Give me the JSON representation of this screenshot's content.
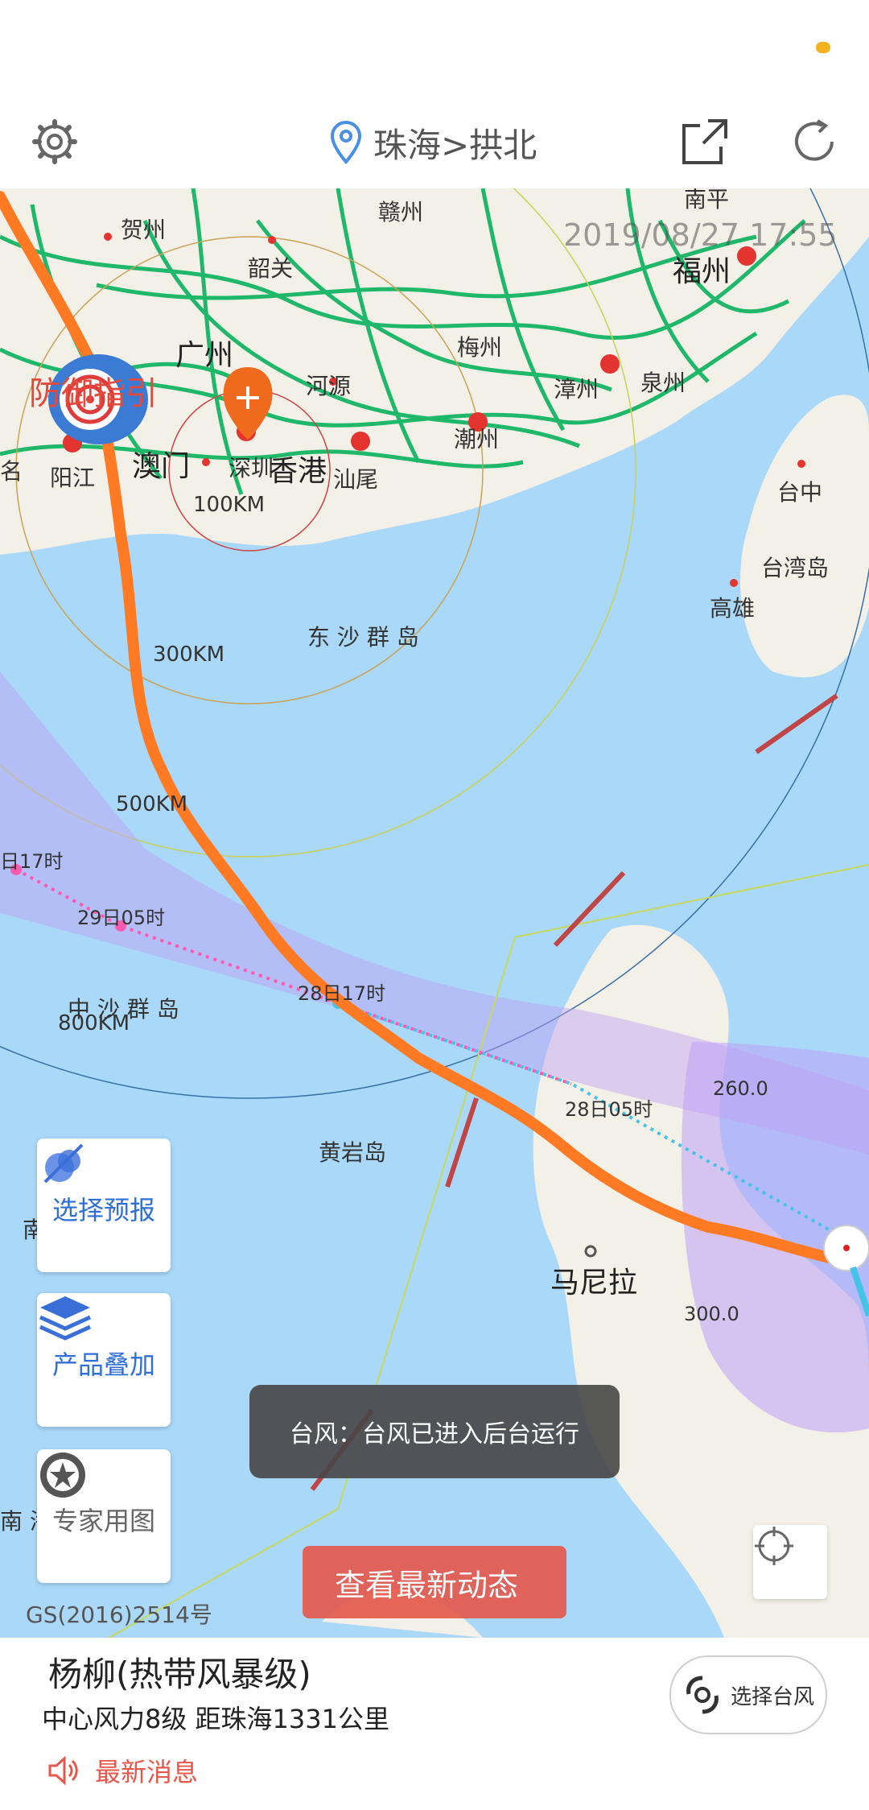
{
  "status": {
    "indicator_color": "#f2b21f"
  },
  "topbar": {
    "location": "珠海>拱北",
    "settings_icon": "gear-icon",
    "location_icon": "location-pin-icon",
    "share_icon": "share-icon",
    "refresh_icon": "refresh-icon"
  },
  "map": {
    "timestamp": "2019/08/27 17:55",
    "fangyu_label": "防御指引",
    "cities": {
      "heyuan": "河源",
      "meizhou": "梅州",
      "ganzhou": "赣州",
      "hezhou": "贺州",
      "shaoguan": "韶关",
      "guangzhou": "广州",
      "macau": "澳门",
      "hongkong": "香港",
      "shenzhen": "深圳",
      "shanwei": "汕尾",
      "chaozhou": "潮州",
      "zhangzhou": "漳州",
      "quanzhou": "泉州",
      "fuzhou": "福州",
      "yangjiang": "阳江",
      "nanping": "南平",
      "taizhong": "台中",
      "taiwan_island": "台湾岛",
      "gaoxiong": "高雄",
      "dongsha": "东 沙 群 岛",
      "zhongsha": "中 沙 群 岛",
      "huangyan": "黄岩岛",
      "manila": "马尼拉",
      "nan_left": "南",
      "nan_bottom": "南 海",
      "edge_left": "名"
    },
    "rings": {
      "r100": "100KM",
      "r300": "300KM",
      "r500": "500KM",
      "r800": "800KM"
    },
    "forecast_times": {
      "t1": "日17时",
      "t2": "29日05时",
      "t3": "28日17时",
      "t4": "28日05时"
    },
    "readings": {
      "r1": "260.0",
      "r2": "300.0"
    },
    "track_color": "#ff7a23"
  },
  "side_buttons": {
    "forecast": "选择预报",
    "overlay": "产品叠加",
    "expert": "专家用图"
  },
  "latest_button": "查看最新动态",
  "toast": "台风：台风已进入后台运行",
  "map_credit": "GS(2016)2514号",
  "info": {
    "title": "杨柳(热带风暴级)",
    "detail": "中心风力8级 距珠海1331公里",
    "news": "最新消息",
    "select_typhoon": "选择台风"
  }
}
